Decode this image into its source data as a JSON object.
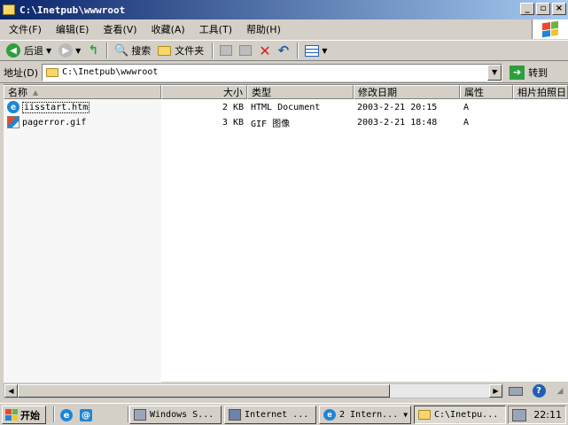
{
  "window": {
    "title": "C:\\Inetpub\\wwwroot",
    "min_label": "_",
    "max_label": "▫",
    "close_label": "×"
  },
  "menu": {
    "items": [
      "文件(F)",
      "编辑(E)",
      "查看(V)",
      "收藏(A)",
      "工具(T)",
      "帮助(H)"
    ]
  },
  "toolbar": {
    "back_label": "后退",
    "search_label": "搜索",
    "folders_label": "文件夹"
  },
  "address": {
    "label": "地址(D)",
    "value": "C:\\Inetpub\\wwwroot",
    "go_label": "转到"
  },
  "list": {
    "columns": [
      "名称",
      "大小",
      "类型",
      "修改日期",
      "属性",
      "相片拍照日"
    ],
    "rows": [
      {
        "name": "iisstart.htm",
        "size": "2 KB",
        "type": "HTML Document",
        "modified": "2003-2-21 20:15",
        "attr": "A",
        "icon": "ie-document-icon"
      },
      {
        "name": "pagerror.gif",
        "size": "3 KB",
        "type": "GIF 图像",
        "modified": "2003-2-21 18:48",
        "attr": "A",
        "icon": "gif-image-icon"
      }
    ]
  },
  "taskbar": {
    "start_label": "开始",
    "tasks": [
      {
        "label": "Windows S...",
        "active": false
      },
      {
        "label": "Internet ...",
        "active": false
      },
      {
        "label": "2 Intern...",
        "active": false
      },
      {
        "label": "C:\\Inetpu...",
        "active": true
      }
    ],
    "clock": "22:11"
  },
  "colors": {
    "title_start": "#0a246a",
    "title_end": "#a6caf0",
    "face": "#d4d0c8"
  }
}
